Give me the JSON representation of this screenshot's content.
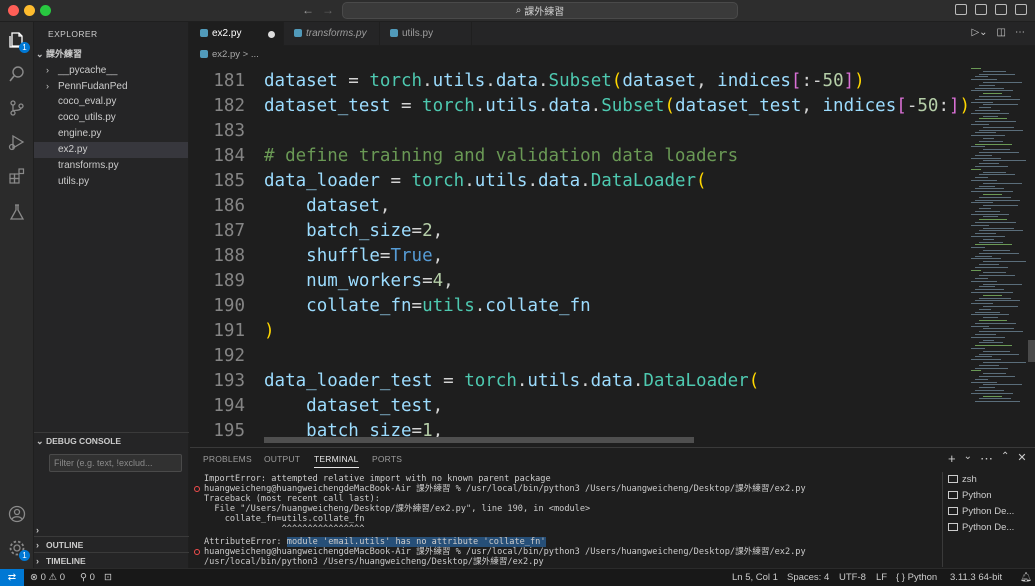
{
  "window": {
    "title": "課外練習",
    "colors": {
      "close": "#ff5f57",
      "minimize": "#febc2e",
      "maximize": "#28c840",
      "accent": "#0078d4"
    }
  },
  "explorer": {
    "header": "EXPLORER",
    "root": "課外練習",
    "items": [
      {
        "label": "__pycache__",
        "kind": "folder"
      },
      {
        "label": "PennFudanPed",
        "kind": "folder"
      },
      {
        "label": "coco_eval.py",
        "kind": "file"
      },
      {
        "label": "coco_utils.py",
        "kind": "file"
      },
      {
        "label": "engine.py",
        "kind": "file"
      },
      {
        "label": "ex2.py",
        "kind": "file",
        "selected": true
      },
      {
        "label": "transforms.py",
        "kind": "file"
      },
      {
        "label": "utils.py",
        "kind": "file"
      }
    ],
    "debug_console": "DEBUG CONSOLE",
    "filter_placeholder": "Filter (e.g. text, !exclud...",
    "outline": "OUTLINE",
    "timeline": "TIMELINE"
  },
  "tabs": [
    {
      "label": "ex2.py",
      "active": true,
      "modified": true
    },
    {
      "label": "transforms.py",
      "active": false
    },
    {
      "label": "utils.py",
      "active": false
    }
  ],
  "breadcrumb": "ex2.py > ...",
  "editor": {
    "lines": [
      {
        "n": "181",
        "text": "dataset = torch.utils.data.Subset(dataset, indices[:-50])"
      },
      {
        "n": "182",
        "text": "dataset_test = torch.utils.data.Subset(dataset_test, indices[-50:])"
      },
      {
        "n": "183",
        "text": ""
      },
      {
        "n": "184",
        "text": "# define training and validation data loaders"
      },
      {
        "n": "185",
        "text": "data_loader = torch.utils.data.DataLoader("
      },
      {
        "n": "186",
        "text": "    dataset,"
      },
      {
        "n": "187",
        "text": "    batch_size=2,"
      },
      {
        "n": "188",
        "text": "    shuffle=True,"
      },
      {
        "n": "189",
        "text": "    num_workers=4,"
      },
      {
        "n": "190",
        "text": "    collate_fn=utils.collate_fn"
      },
      {
        "n": "191",
        "text": ")"
      },
      {
        "n": "192",
        "text": ""
      },
      {
        "n": "193",
        "text": "data_loader_test = torch.utils.data.DataLoader("
      },
      {
        "n": "194",
        "text": "    dataset_test,"
      },
      {
        "n": "195",
        "text": "    batch_size=1,"
      }
    ]
  },
  "panel": {
    "tabs": [
      "PROBLEMS",
      "OUTPUT",
      "TERMINAL",
      "PORTS"
    ],
    "active_tab": "TERMINAL",
    "terminal_lines": [
      {
        "text": "ImportError: attempted relative import with no known parent package",
        "error": false
      },
      {
        "text": "huangweicheng@huangweichengdeMacBook-Air 課外練習 % /usr/local/bin/python3 /Users/huangweicheng/Desktop/課外練習/ex2.py",
        "error": true
      },
      {
        "text": "Traceback (most recent call last):",
        "error": false
      },
      {
        "text": "  File \"/Users/huangweicheng/Desktop/課外練習/ex2.py\", line 190, in <module>",
        "error": false
      },
      {
        "text": "    collate_fn=utils.collate_fn",
        "error": false
      },
      {
        "text": "               ^^^^^^^^^^^^^^^^",
        "error": false
      },
      {
        "text": "AttributeError: ",
        "highlight": "module 'email.utils' has no attribute 'collate_fn'",
        "error": false
      },
      {
        "text": "huangweicheng@huangweichengdeMacBook-Air 課外練習 % /usr/local/bin/python3 /Users/huangweicheng/Desktop/課外練習/ex2.py",
        "error": true
      },
      {
        "text": "/usr/local/bin/python3 /Users/huangweicheng/Desktop/課外練習/ex2.py",
        "error": false
      }
    ],
    "terminals": [
      "zsh",
      "Python",
      "Python De...",
      "Python De..."
    ]
  },
  "status": {
    "errors": "0",
    "warnings": "0",
    "ports": "0",
    "position": "Ln 5, Col 1",
    "spaces": "Spaces: 4",
    "encoding": "UTF-8",
    "eol": "LF",
    "language": "Python",
    "interpreter": "3.11.3 64-bit"
  }
}
